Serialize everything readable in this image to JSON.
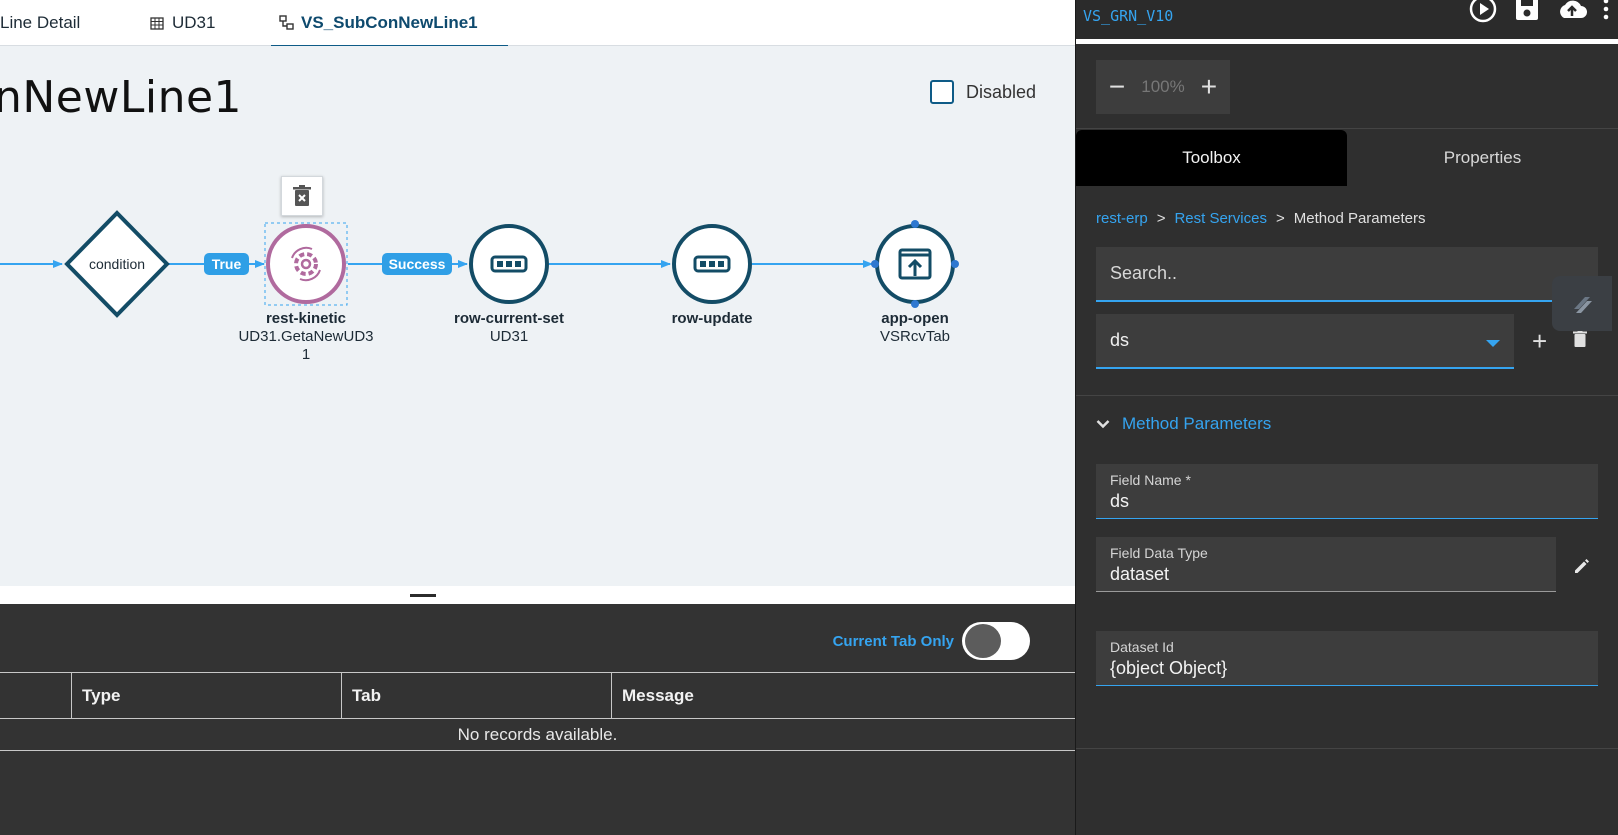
{
  "tabs": [
    {
      "label": "Line Detail",
      "icon": "none"
    },
    {
      "label": "UD31",
      "icon": "table-icon"
    },
    {
      "label": "VS_SubConNewLine1",
      "icon": "workflow-icon",
      "active": true
    }
  ],
  "canvas": {
    "title": "nNewLine1",
    "disabled_label": "Disabled",
    "nodes": [
      {
        "type": "condition",
        "label": "condition"
      },
      {
        "type": "rest-kinetic",
        "title": "rest-kinetic",
        "subtitle": "UD31.GetaNewUD3",
        "subtitle2": "1"
      },
      {
        "type": "row-current-set",
        "title": "row-current-set",
        "subtitle": "UD31"
      },
      {
        "type": "row-update",
        "title": "row-update",
        "subtitle": ""
      },
      {
        "type": "app-open",
        "title": "app-open",
        "subtitle": "VSRcvTab"
      }
    ],
    "edge_labels": {
      "true": "True",
      "success": "Success"
    },
    "colors": {
      "node_border": "#134c66",
      "selected_node": "#b06a9e",
      "edge": "#35a4f0"
    }
  },
  "bottom": {
    "toggle_label": "Current Tab Only",
    "columns": [
      "",
      "Type",
      "Tab",
      "Message"
    ],
    "empty_text": "No records available."
  },
  "right": {
    "title": "VS_GRN_V10",
    "zoom": {
      "minus": "−",
      "value": "100%",
      "plus": "+"
    },
    "tabs": [
      "Toolbox",
      "Properties"
    ],
    "breadcrumb": [
      "rest-erp",
      "Rest Services",
      "Method Parameters"
    ],
    "breadcrumb_sep": ">",
    "search_placeholder": "Search..",
    "select_value": "ds",
    "section_title": "Method Parameters",
    "fields": [
      {
        "label": "Field Name *",
        "value": "ds"
      },
      {
        "label": "Field Data Type",
        "value": "dataset"
      },
      {
        "label": "Dataset Id",
        "value": "{object Object}"
      }
    ],
    "add_symbol": "+"
  }
}
